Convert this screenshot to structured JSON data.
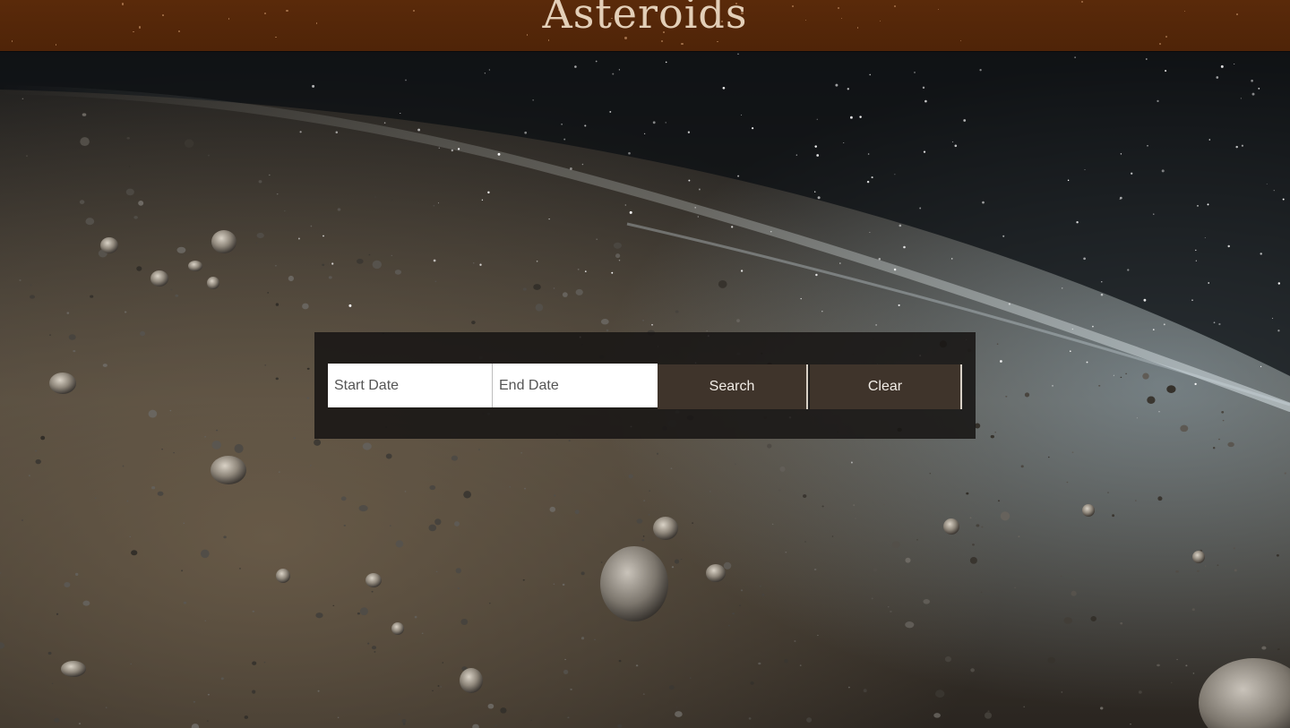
{
  "header": {
    "title": "Asteroids",
    "background_color": "#552709",
    "title_color": "#e3cfb8"
  },
  "background": {
    "description_icon": "asteroid-field-image"
  },
  "search": {
    "start_date_placeholder": "Start Date",
    "end_date_placeholder": "End Date",
    "start_date_value": "",
    "end_date_value": "",
    "search_label": "Search",
    "clear_label": "Clear",
    "button_color": "#3f342b"
  }
}
